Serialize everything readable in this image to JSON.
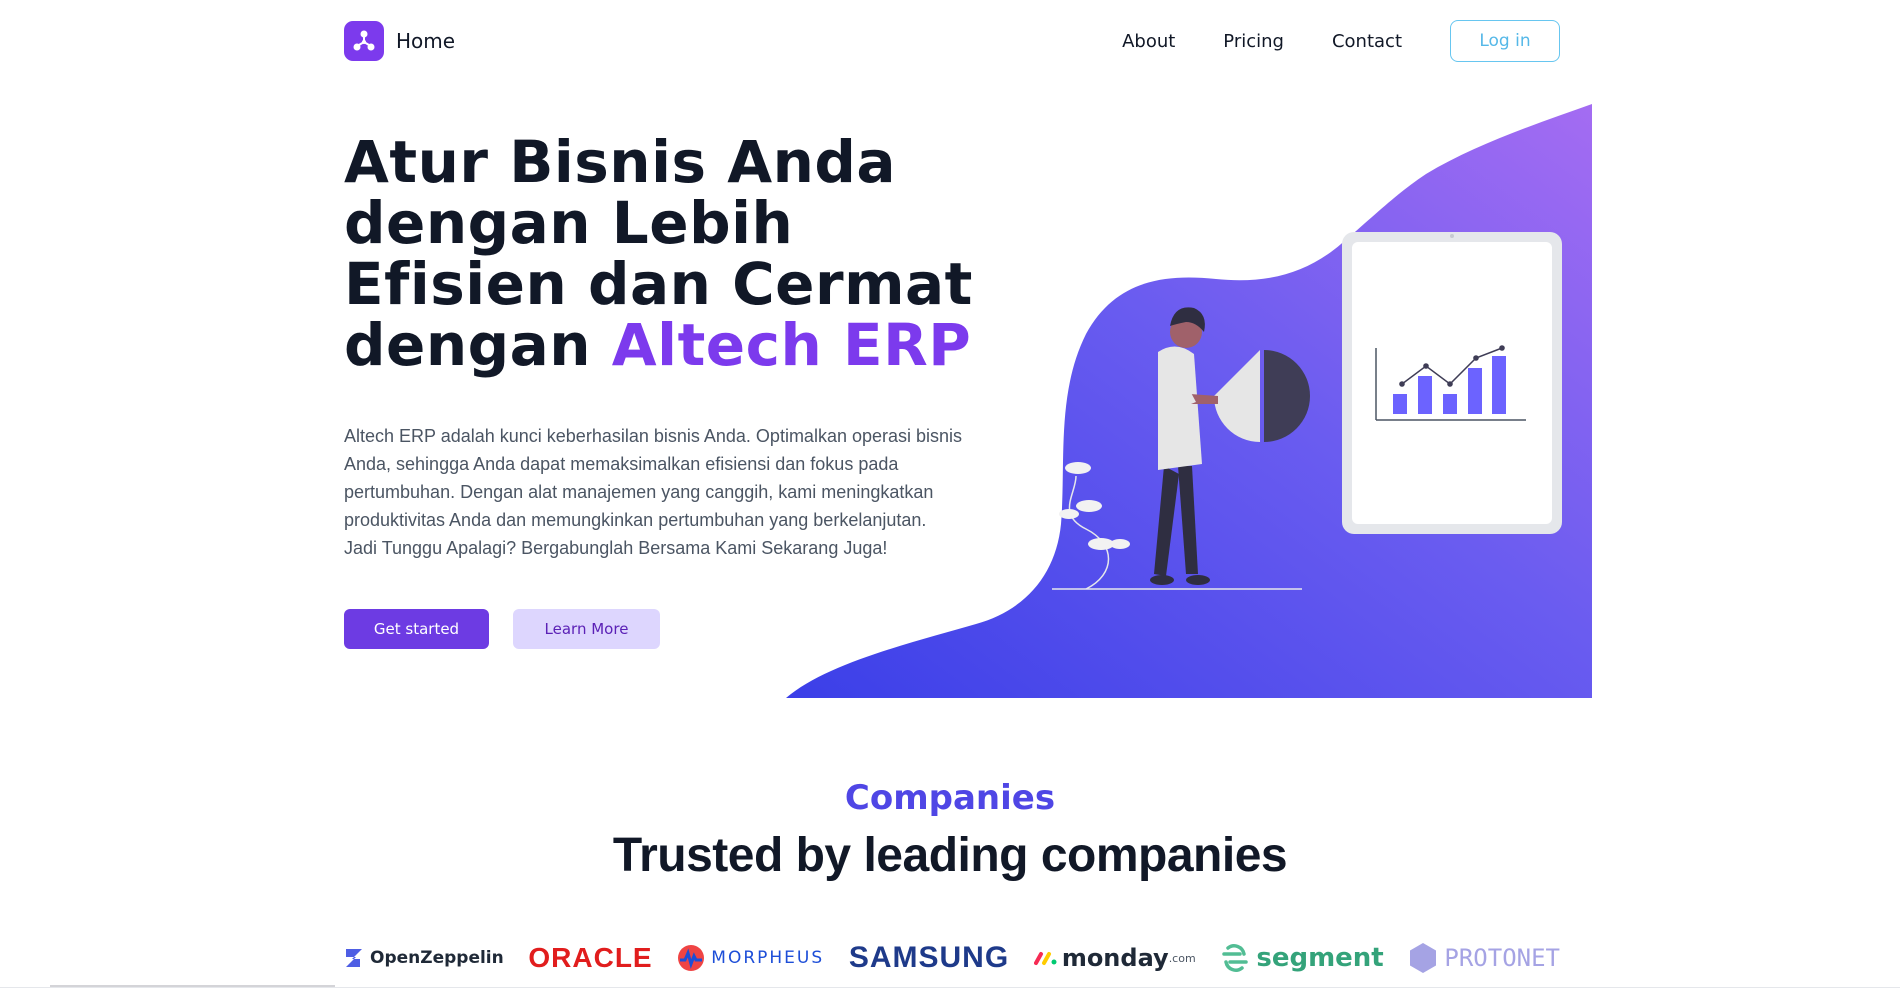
{
  "nav": {
    "brand_label": "Home",
    "links": [
      "About",
      "Pricing",
      "Contact"
    ],
    "login_label": "Log in"
  },
  "hero": {
    "title_lines": [
      "Atur Bisnis Anda",
      "dengan Lebih",
      "Efisien dan Cermat"
    ],
    "title_prefix": "dengan ",
    "title_accent": "Altech ERP",
    "description": "Altech ERP adalah kunci keberhasilan bisnis Anda. Optimalkan operasi bisnis Anda, sehingga Anda dapat memaksimalkan efisiensi dan fokus pada pertumbuhan. Dengan alat manajemen yang canggih, kami meningkatkan produktivitas Anda dan memungkinkan pertumbuhan yang berkelanjutan. Jadi Tunggu Apalagi? Bergabunglah Bersama Kami Sekarang Juga!",
    "primary_button": "Get started",
    "secondary_button": "Learn More"
  },
  "companies": {
    "eyebrow": "Companies",
    "title": "Trusted by leading companies",
    "logos": [
      {
        "name": "OpenZeppelin",
        "icon": "openzeppelin-icon"
      },
      {
        "name": "ORACLE",
        "icon": "oracle-wordmark"
      },
      {
        "name": "MORPHEUS",
        "icon": "morpheus-icon"
      },
      {
        "name": "SAMSUNG",
        "icon": "samsung-wordmark"
      },
      {
        "name": "monday",
        "suffix": ".com",
        "icon": "monday-icon"
      },
      {
        "name": "segment",
        "icon": "segment-icon"
      },
      {
        "name": "PROTONET",
        "icon": "protonet-icon"
      }
    ]
  },
  "colors": {
    "accent": "#7c3aed",
    "eyebrow": "#4f46e5",
    "blob_start": "#3b3fe8",
    "blob_end": "#a46cf2",
    "login_border": "#67c6f0"
  }
}
